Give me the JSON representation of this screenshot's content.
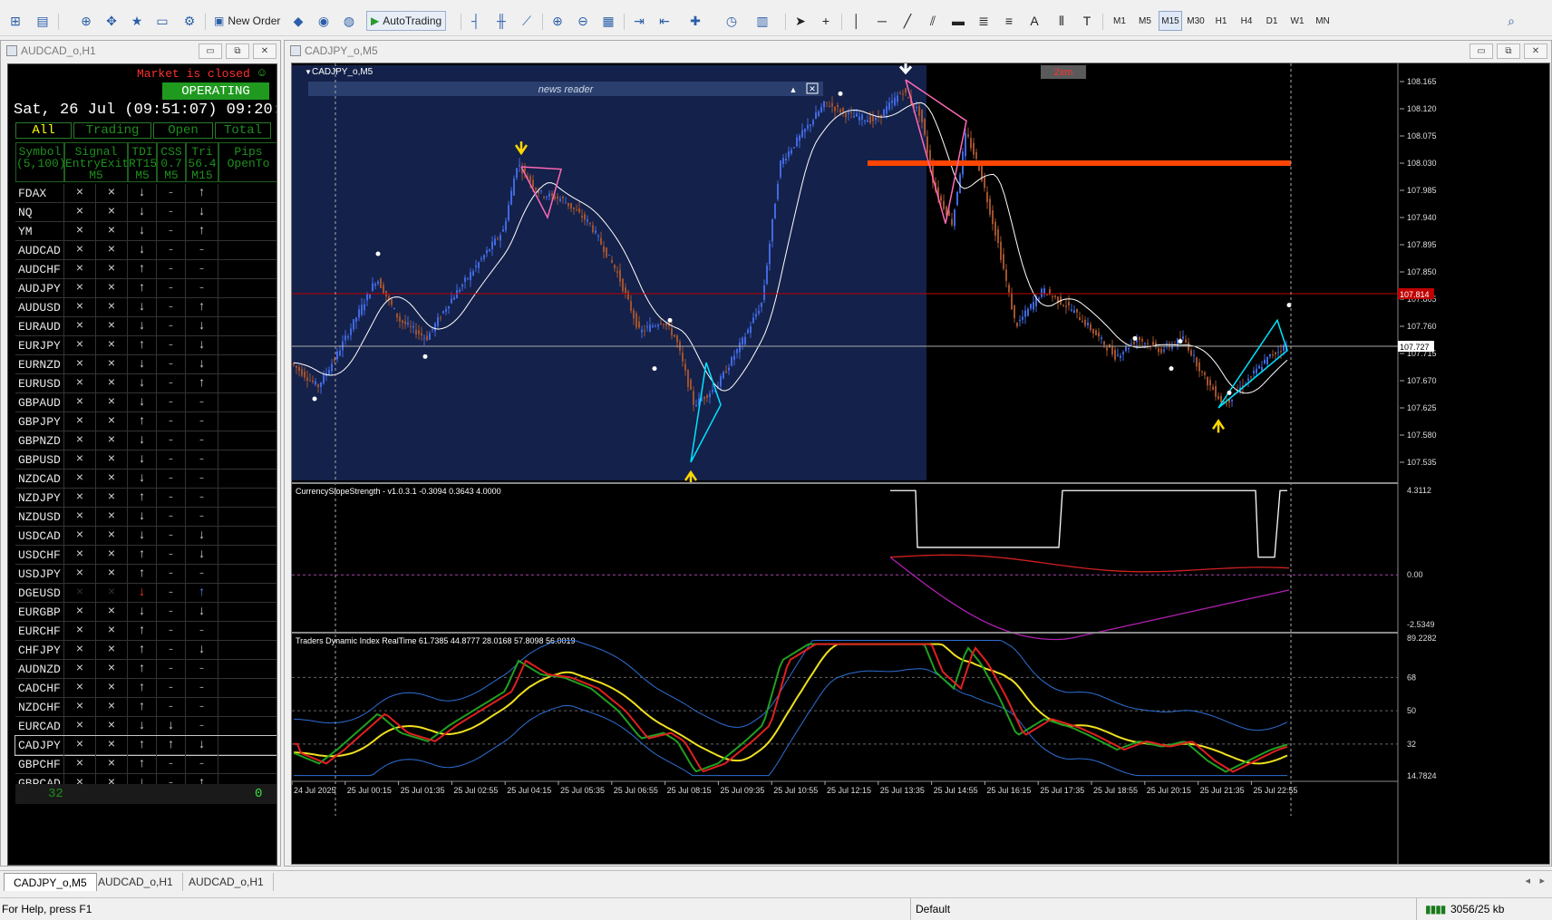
{
  "toolbar": {
    "new_order_label": "New Order",
    "autotrading_label": "AutoTrading",
    "timeframes": [
      "M1",
      "M5",
      "M15",
      "M30",
      "H1",
      "H4",
      "D1",
      "W1",
      "MN"
    ],
    "active_timeframe": "M15"
  },
  "left_window": {
    "title": "AUDCAD_o,H1"
  },
  "chart_window": {
    "title": "CADJPY_o,M5"
  },
  "dashboard": {
    "market_status": "Market is closed",
    "status_icon": "☺",
    "operating_label": "OPERATING",
    "datetime": "Sat, 26 Jul (09:51:07) 09:20:",
    "filter_tabs": [
      "All",
      "Trading",
      "Open",
      "Total"
    ],
    "headers": [
      {
        "l1": "Symbol",
        "l2": "(5,100)"
      },
      {
        "l1": "Signal",
        "l2": "EntryExit",
        "l3": "M5"
      },
      {
        "l1": "TDI",
        "l2": "RT15",
        "l3": "M5"
      },
      {
        "l1": "CSS",
        "l2": "0.7",
        "l3": "M5"
      },
      {
        "l1": "Tri",
        "l2": "56.4",
        "l3": "M15"
      },
      {
        "l1": "Pips",
        "l2": "OpenTo"
      }
    ],
    "rows": [
      {
        "s": "FDAX",
        "e": "×",
        "x": "×",
        "t": "↓",
        "c": "-",
        "r": "↑"
      },
      {
        "s": "NQ",
        "e": "×",
        "x": "×",
        "t": "↓",
        "c": "-",
        "r": "↓"
      },
      {
        "s": "YM",
        "e": "×",
        "x": "×",
        "t": "↓",
        "c": "-",
        "r": "↑"
      },
      {
        "s": "AUDCAD",
        "e": "×",
        "x": "×",
        "t": "↓",
        "c": "-",
        "r": "-"
      },
      {
        "s": "AUDCHF",
        "e": "×",
        "x": "×",
        "t": "↑",
        "c": "-",
        "r": "-"
      },
      {
        "s": "AUDJPY",
        "e": "×",
        "x": "×",
        "t": "↑",
        "c": "-",
        "r": "-"
      },
      {
        "s": "AUDUSD",
        "e": "×",
        "x": "×",
        "t": "↓",
        "c": "-",
        "r": "↑"
      },
      {
        "s": "EURAUD",
        "e": "×",
        "x": "×",
        "t": "↓",
        "c": "-",
        "r": "↓"
      },
      {
        "s": "EURJPY",
        "e": "×",
        "x": "×",
        "t": "↑",
        "c": "-",
        "r": "↓"
      },
      {
        "s": "EURNZD",
        "e": "×",
        "x": "×",
        "t": "↓",
        "c": "-",
        "r": "↓"
      },
      {
        "s": "EURUSD",
        "e": "×",
        "x": "×",
        "t": "↓",
        "c": "-",
        "r": "↑"
      },
      {
        "s": "GBPAUD",
        "e": "×",
        "x": "×",
        "t": "↓",
        "c": "-",
        "r": "-"
      },
      {
        "s": "GBPJPY",
        "e": "×",
        "x": "×",
        "t": "↑",
        "c": "-",
        "r": "-"
      },
      {
        "s": "GBPNZD",
        "e": "×",
        "x": "×",
        "t": "↓",
        "c": "-",
        "r": "-"
      },
      {
        "s": "GBPUSD",
        "e": "×",
        "x": "×",
        "t": "↓",
        "c": "-",
        "r": "-"
      },
      {
        "s": "NZDCAD",
        "e": "×",
        "x": "×",
        "t": "↓",
        "c": "-",
        "r": "-"
      },
      {
        "s": "NZDJPY",
        "e": "×",
        "x": "×",
        "t": "↑",
        "c": "-",
        "r": "-"
      },
      {
        "s": "NZDUSD",
        "e": "×",
        "x": "×",
        "t": "↓",
        "c": "-",
        "r": "-"
      },
      {
        "s": "USDCAD",
        "e": "×",
        "x": "×",
        "t": "↓",
        "c": "-",
        "r": "↓"
      },
      {
        "s": "USDCHF",
        "e": "×",
        "x": "×",
        "t": "↑",
        "c": "-",
        "r": "↓"
      },
      {
        "s": "USDJPY",
        "e": "×",
        "x": "×",
        "t": "↑",
        "c": "-",
        "r": "-"
      },
      {
        "s": "DGEUSD",
        "e": "×",
        "x": "×",
        "t": "↓",
        "c": "-",
        "r": "↑",
        "hl": true
      },
      {
        "s": "EURGBP",
        "e": "×",
        "x": "×",
        "t": "↓",
        "c": "-",
        "r": "↓"
      },
      {
        "s": "EURCHF",
        "e": "×",
        "x": "×",
        "t": "↑",
        "c": "-",
        "r": "-"
      },
      {
        "s": "CHFJPY",
        "e": "×",
        "x": "×",
        "t": "↑",
        "c": "-",
        "r": "↓"
      },
      {
        "s": "AUDNZD",
        "e": "×",
        "x": "×",
        "t": "↑",
        "c": "-",
        "r": "-"
      },
      {
        "s": "CADCHF",
        "e": "×",
        "x": "×",
        "t": "↑",
        "c": "-",
        "r": "-"
      },
      {
        "s": "NZDCHF",
        "e": "×",
        "x": "×",
        "t": "↑",
        "c": "-",
        "r": "-"
      },
      {
        "s": "EURCAD",
        "e": "×",
        "x": "×",
        "t": "↓",
        "c": "↓",
        "r": "-"
      },
      {
        "s": "CADJPY",
        "e": "×",
        "x": "×",
        "t": "↑",
        "c": "↑",
        "r": "↓",
        "sel": true
      },
      {
        "s": "GBPCHF",
        "e": "×",
        "x": "×",
        "t": "↑",
        "c": "-",
        "r": "-"
      },
      {
        "s": "GBPCAD",
        "e": "×",
        "x": "×",
        "t": "↓",
        "c": "-",
        "r": "↑"
      }
    ],
    "footer": {
      "count": "32",
      "total": "0"
    }
  },
  "chart": {
    "symbol_label": "CADJPY_o,M5",
    "news_reader_label": "news reader",
    "badge": "2xm",
    "price_ticks": [
      "108.165",
      "108.120",
      "108.075",
      "108.030",
      "107.985",
      "107.940",
      "107.895",
      "107.850",
      "107.805",
      "107.760",
      "107.715",
      "107.670",
      "107.625",
      "107.580",
      "107.535"
    ],
    "red_line_label": "107.814",
    "current_price_label": "107.727",
    "indicator1_label": "CurrencySlopeStrength - v1.0.3.1 -0.3094 0.3643 4.0000",
    "indicator1_ticks": [
      "4.3112",
      "0.00",
      "-2.5349"
    ],
    "indicator2_label": "Traders Dynamic Index RealTime 61.7385 44.8777 28.0168 57.8098 56.0019",
    "indicator2_ticks": [
      "89.2282",
      "68",
      "50",
      "32",
      "14.7824"
    ],
    "time_labels": [
      "24 Jul 2025",
      "25 Jul 00:15",
      "25 Jul 01:35",
      "25 Jul 02:55",
      "25 Jul 04:15",
      "25 Jul 05:35",
      "25 Jul 06:55",
      "25 Jul 08:15",
      "25 Jul 09:35",
      "25 Jul 10:55",
      "25 Jul 12:15",
      "25 Jul 13:35",
      "25 Jul 14:55",
      "25 Jul 16:15",
      "25 Jul 17:35",
      "25 Jul 18:55",
      "25 Jul 20:15",
      "25 Jul 21:35",
      "25 Jul 22:55"
    ],
    "colors": {
      "bull": "#4169e1",
      "bear": "#a0522d",
      "session_bg": "#14214a",
      "ma": "#ffffff",
      "zz_pink": "#ff69b4",
      "zz_cyan": "#00e5ff",
      "resistance": "#ff4500",
      "arrow": "#ffd700",
      "red_line": "#c00000"
    }
  },
  "tabs": [
    "CADJPY_o,M5",
    "AUDCAD_o,H1",
    "AUDCAD_o,H1"
  ],
  "status": {
    "help": "For Help, press F1",
    "profile": "Default",
    "traffic": "3056/25 kb"
  }
}
